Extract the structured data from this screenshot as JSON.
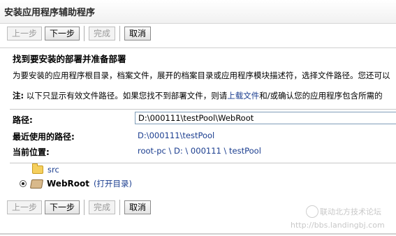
{
  "window": {
    "title": "安装应用程序辅助程序"
  },
  "buttons": {
    "back": "上一步",
    "next": "下一步",
    "finish": "完成",
    "cancel": "取消"
  },
  "heading": "找到要安装的部署并准备部署",
  "description": "为要安装的应用程序根目录，档案文件，展开的档案目录或应用程序模块描述符，选择文件路径。您还可以",
  "note": {
    "prefix": "注:",
    "text1": " 以下只显示有效文件路径。如果您找不到部署文件，则请",
    "link": "上载文件",
    "text2": "和/或确认您的应用程序包含所需的"
  },
  "form": {
    "path_label": "路径:",
    "path_value": "D:\\000111\\testPool\\WebRoot",
    "recent_label": "最近使用的路径:",
    "recent_value": "D:\\000111\\testPool",
    "location_label": "当前位置:",
    "location_value": "root-pc \\ D: \\ 000111 \\ testPool"
  },
  "tree": {
    "folder1": "src",
    "selected_item": "WebRoot",
    "open_link": "(打开目录)"
  },
  "watermark": {
    "name": "联动北方技术论坛",
    "url": "http://bbs.landingbj.com"
  }
}
